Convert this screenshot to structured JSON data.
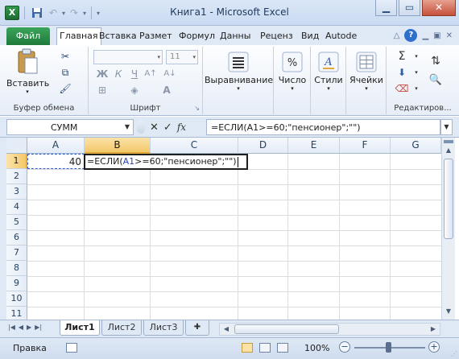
{
  "window": {
    "title": "Книга1  -  Microsoft Excel",
    "logo_letter": "X"
  },
  "tabs": [
    {
      "label": "Файл",
      "id": "file"
    },
    {
      "label": "Главная",
      "id": "home",
      "active": true
    },
    {
      "label": "Вставка",
      "id": "insert"
    },
    {
      "label": "Размет",
      "id": "layout"
    },
    {
      "label": "Формул",
      "id": "formulas"
    },
    {
      "label": "Данны",
      "id": "data"
    },
    {
      "label": "Реценз",
      "id": "review"
    },
    {
      "label": "Вид",
      "id": "view"
    },
    {
      "label": "Autode",
      "id": "autodesk"
    }
  ],
  "ribbon": {
    "clipboard": {
      "paste_label": "Вставить",
      "group_label": "Буфер обмена"
    },
    "font": {
      "size_value": "11",
      "group_label": "Шрифт",
      "bold": "Ж",
      "italic": "К",
      "underline": "Ч"
    },
    "alignment": {
      "label": "Выравнивание"
    },
    "number": {
      "label": "Число"
    },
    "styles": {
      "label": "Стили"
    },
    "cells": {
      "label": "Ячейки"
    },
    "editing": {
      "group_label": "Редактиров..."
    }
  },
  "formula_bar": {
    "name_box": "СУММ",
    "formula": "=ЕСЛИ(A1>=60;\"пенсионер\";\"\")",
    "fx": "fx"
  },
  "grid": {
    "columns": [
      "A",
      "B",
      "C",
      "D",
      "E",
      "F",
      "G"
    ],
    "rows": [
      "1",
      "2",
      "3",
      "4",
      "5",
      "6",
      "7",
      "8",
      "9",
      "10",
      "11"
    ],
    "cell_a1": "40",
    "cell_b1_prefix": "=ЕСЛИ(",
    "cell_b1_ref": "A1",
    "cell_b1_suffix": ">=60;\"пенсионер\";\"\")"
  },
  "sheets": [
    {
      "label": "Лист1",
      "active": true
    },
    {
      "label": "Лист2"
    },
    {
      "label": "Лист3"
    }
  ],
  "status": {
    "mode": "Правка",
    "zoom": "100%"
  },
  "colors": {
    "file_tab": "#207a3c",
    "selection_header": "#f4c86a",
    "reference_blue": "#2e3fc7"
  }
}
